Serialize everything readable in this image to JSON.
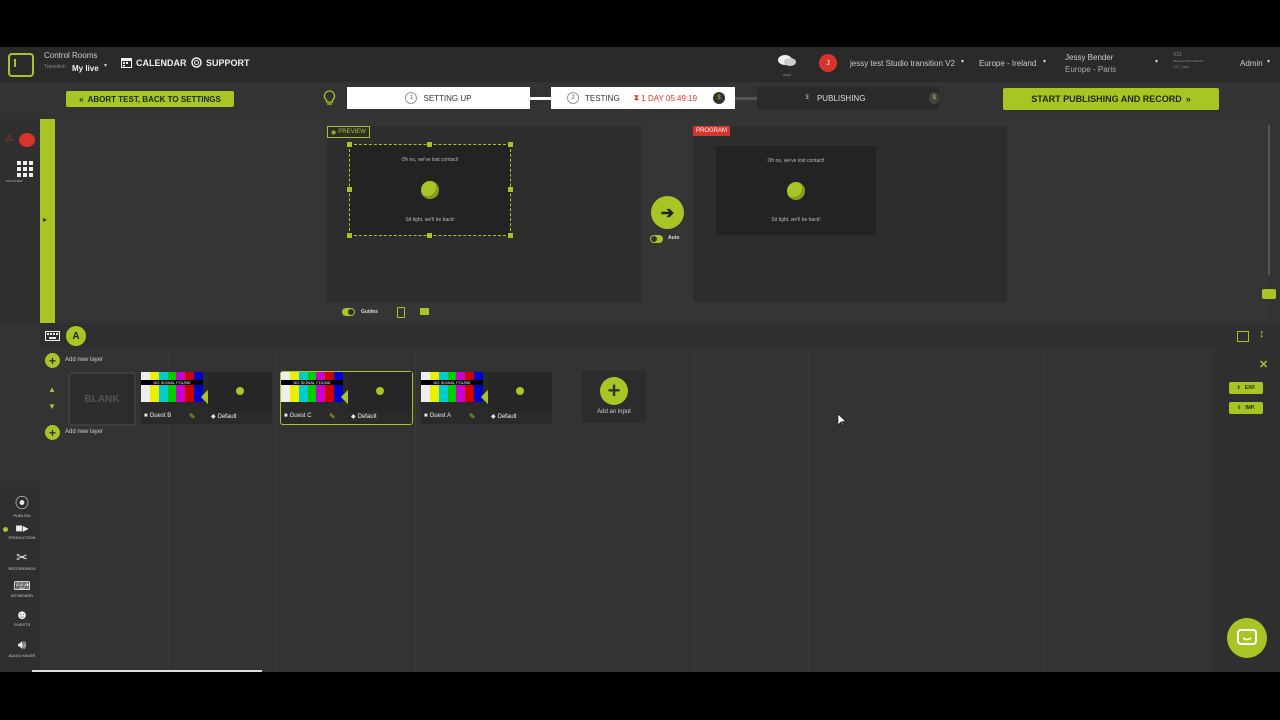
{
  "header": {
    "control_rooms_label": "Control Rooms",
    "room_name": "My live",
    "room_sub": "Transition",
    "nav": [
      {
        "label": "CALENDAR",
        "icon": "calendar-icon"
      },
      {
        "label": "SUPPORT",
        "icon": "support-icon"
      }
    ],
    "chat_label": "CHAT",
    "avatar_initial": "J",
    "studio_name": "jessy test Studio transition V2",
    "region": "Europe - Ireland",
    "user_name": "Jessy Bender",
    "user_location": "Europe - Paris",
    "version_line1": "V12",
    "version_line2": "58ae13bd9b47dddea5",
    "version_line3": "V17_test",
    "role": "Admin"
  },
  "progress": {
    "abort_label": "ABORT TEST, BACK TO SETTINGS",
    "steps": [
      {
        "num": "1",
        "label": "SETTING UP"
      },
      {
        "num": "2",
        "label": "TESTING",
        "timer": "1 DAY 05:49:19"
      },
      {
        "num": "3",
        "label": "PUBLISHING"
      }
    ],
    "start_label": "START PUBLISHING AND RECORD"
  },
  "preview": {
    "tag": "PREVIEW",
    "line1": "Oh no, we've lost contact!",
    "line2": "Sit tight, we'll be back!"
  },
  "program": {
    "tag": "PROGRAM",
    "line1": "Oh no, we've lost contact!",
    "line2": "Sit tight, we'll be back!"
  },
  "controls": {
    "auto_label": "Auto",
    "guides_label": "Guides"
  },
  "sidebar": {
    "top_items": [
      {
        "label": "MULTIVIEW"
      }
    ],
    "bottom_items": [
      {
        "label": "PUBLISH"
      },
      {
        "label": "PRODUCTION"
      },
      {
        "label": "RECORDINGS"
      },
      {
        "label": "KEYBOARD"
      },
      {
        "label": "GUESTS"
      },
      {
        "label": "AUDIO MIXER"
      }
    ]
  },
  "layers": {
    "scene_label": "A",
    "add_layer_label": "Add new layer",
    "blank_label": "BLANK",
    "no_signal_label": "NO SIGNAL FOUND",
    "cards": [
      {
        "input": "Guest B",
        "scene": "Default"
      },
      {
        "input": "Guest C",
        "scene": "Default"
      },
      {
        "input": "Guest A",
        "scene": "Default"
      }
    ],
    "add_input_label": "Add an input",
    "exp_label": "EXP.",
    "imp_label": "IMP."
  },
  "colors": {
    "accent": "#a8c526",
    "danger": "#d9342b"
  }
}
